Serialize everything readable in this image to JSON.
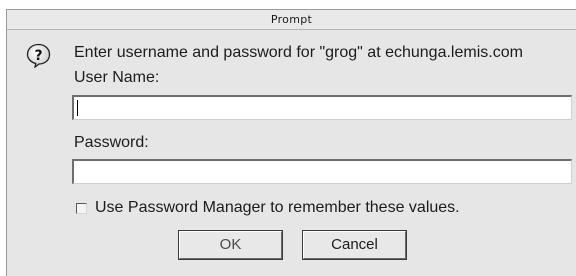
{
  "window": {
    "title": "Prompt"
  },
  "dialog": {
    "icon": "question-icon",
    "message": "Enter username and password for \"grog\" at echunga.lemis.com",
    "username_label": "User Name:",
    "username_value": "",
    "password_label": "Password:",
    "password_value": "",
    "remember_label": "Use Password Manager to remember these values.",
    "remember_checked": false,
    "ok_label": "OK",
    "cancel_label": "Cancel"
  }
}
